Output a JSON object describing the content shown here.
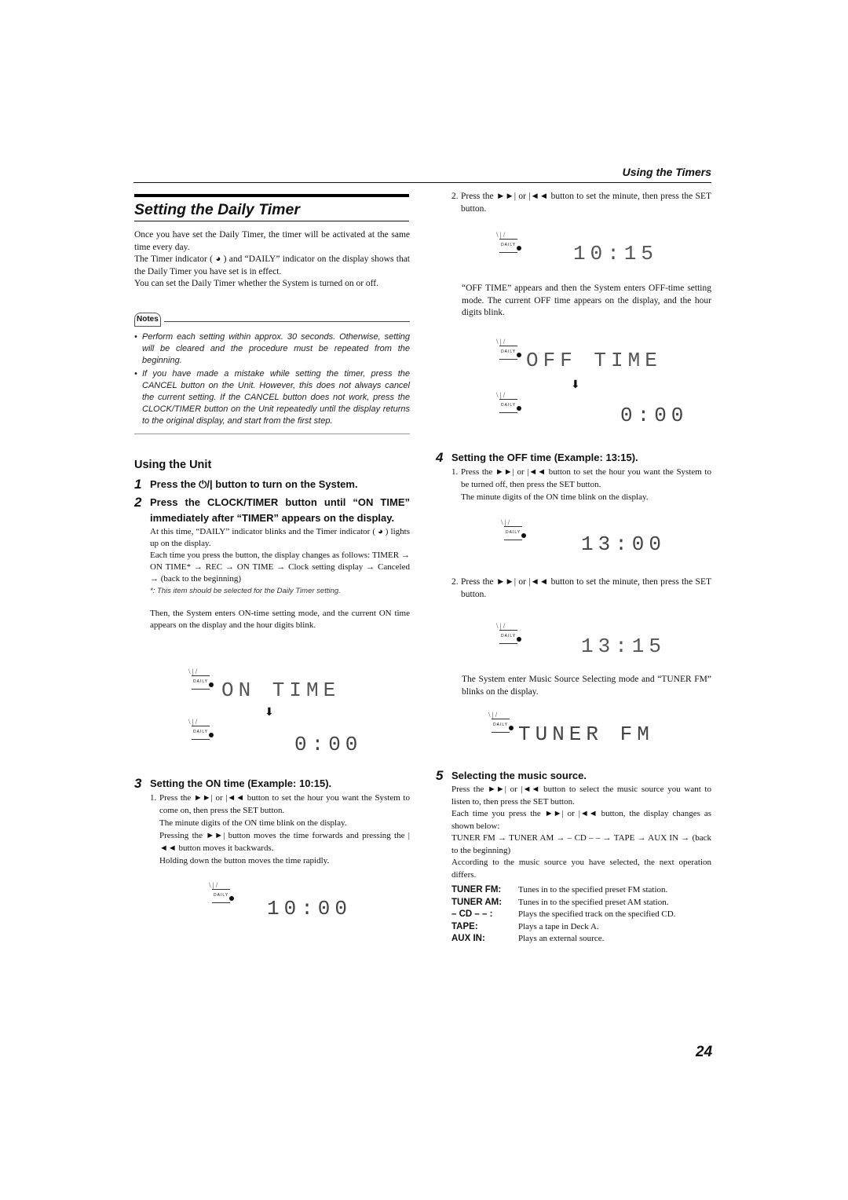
{
  "header": {
    "running_head": "Using the Timers",
    "page_number": "24"
  },
  "title": "Setting the Daily Timer",
  "intro": [
    "Once you have set the Daily Timer, the timer will be activated at the same time every day.",
    "The Timer indicator ( ◕ ) and “DAILY” indicator on the display shows that the Daily Timer you have set is in effect.",
    "You can set the Daily Timer whether the System is turned on or off."
  ],
  "notes": {
    "label": "Notes",
    "items": [
      "Perform each setting within approx. 30 seconds. Otherwise, setting will be cleared and the procedure must be repeated from the beginning.",
      "If you have made a mistake while setting the timer, press the CANCEL button on the Unit. However, this does not always cancel the current setting. If the CANCEL button does not work, press the CLOCK/TIMER button on the Unit repeatedly until the display returns to the original display, and start from the first step."
    ]
  },
  "section": "Using the Unit",
  "steps": {
    "s1": {
      "num": "1",
      "text": "Press the ⏻/| button to turn on the System."
    },
    "s2": {
      "num": "2",
      "text": "Press the CLOCK/TIMER button until “ON TIME” immediately after “TIMER” appears on the display.",
      "body1": "At this time, “DAILY” indicator blinks and the Timer indicator ( ◕ ) lights up on the display.",
      "body2": "Each time you press the button, the display changes as follows: TIMER → ON TIME* → REC → ON TIME → Clock setting display → Canceled → (back to the beginning)",
      "footnote": "*: This item should be selected for the Daily Timer setting.",
      "body3": "Then, the System enters ON-time setting mode, and the current ON time appears on the display and the hour digits blink.",
      "display1": "ON  TIME",
      "display2": "0:00"
    },
    "s3": {
      "num": "3",
      "text": "Setting the ON time (Example: 10:15).",
      "sub1_num": "1.",
      "sub1": "Press the ►►| or |◄◄ button to set the hour you want the System to come on, then press the SET button.",
      "sub1_b": "The minute digits of the ON time blink on the display.",
      "sub1_c": "Pressing the ►►| button moves the time forwards and pressing the |◄◄ button moves it backwards.",
      "sub1_d": "Holding down the button moves the time rapidly.",
      "display": "10:00",
      "sub2_num": "2.",
      "sub2": "Press the ►►| or |◄◄ button to set the minute, then press the SET button.",
      "display_b": "10:15",
      "after": "“OFF TIME” appears and then the System enters OFF-time setting mode. The current OFF time appears on the display, and the hour digits blink.",
      "display_off1": "OFF  TIME",
      "display_off2": "0:00"
    },
    "s4": {
      "num": "4",
      "text": "Setting the OFF time (Example: 13:15).",
      "sub1_num": "1.",
      "sub1": "Press the ►►| or |◄◄ button to set the hour you want the System to be turned off, then press the SET button.",
      "sub1_b": "The minute digits of the ON time blink on the display.",
      "display1": "13:00",
      "sub2_num": "2.",
      "sub2": "Press the ►►| or |◄◄ button to set the minute, then press the SET button.",
      "display2": "13:15",
      "after": "The System enter Music Source Selecting mode and “TUNER FM” blinks on the display.",
      "display3": "TUNER FM"
    },
    "s5": {
      "num": "5",
      "text": "Selecting the music source.",
      "body1": "Press the ►►| or |◄◄ button to select the music source you want to listen to, then press the SET button.",
      "body2": "Each time you press the ►►| or |◄◄ button, the display changes as shown below:",
      "body3": "TUNER FM → TUNER AM → – CD – – → TAPE → AUX IN → (back to the beginning)",
      "body4": "According to the music source you have selected, the next operation differs.",
      "sources": [
        {
          "key": "TUNER FM:",
          "desc": "Tunes in to the specified preset FM station."
        },
        {
          "key": "TUNER AM:",
          "desc": "Tunes in to the specified preset AM station."
        },
        {
          "key": "–  CD – – :",
          "desc": "Plays the specified track on the specified CD."
        },
        {
          "key": "TAPE:",
          "desc": "Plays a tape in Deck A."
        },
        {
          "key": "AUX IN:",
          "desc": "Plays an external source."
        }
      ]
    }
  },
  "daily_label": "DAILY"
}
